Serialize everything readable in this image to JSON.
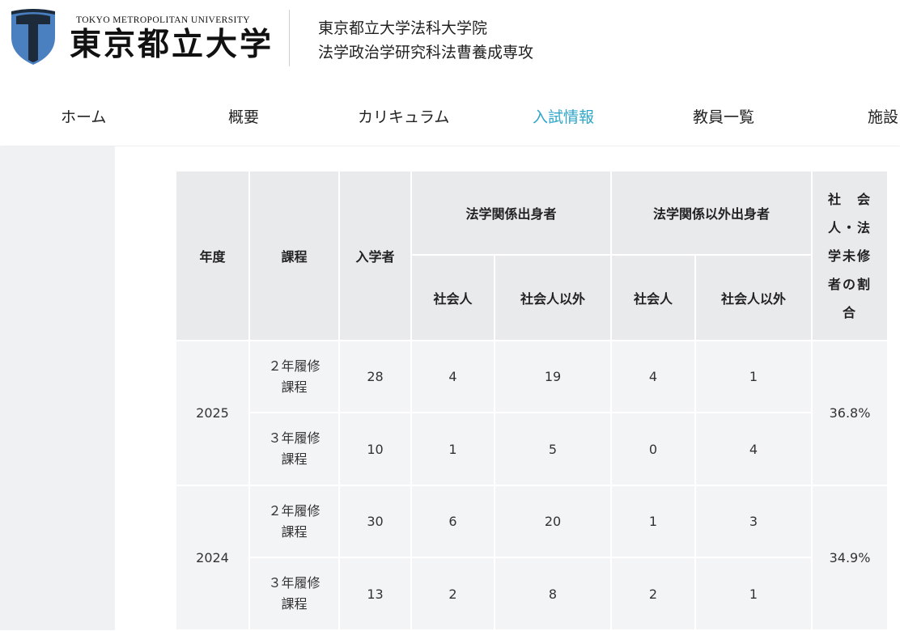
{
  "header": {
    "logo_en": "TOKYO METROPOLITAN UNIVERSITY",
    "logo_ja": "東京都立大学",
    "subtitle_line1": "東京都立大学法科大学院",
    "subtitle_line2": "法学政治学研究科法曹養成専攻",
    "shield_dark": "#1c2a3a",
    "shield_blue": "#4a7fc0"
  },
  "nav": {
    "items": [
      {
        "label": "ホーム"
      },
      {
        "label": "概要"
      },
      {
        "label": "カリキュラム"
      },
      {
        "label": "入試情報"
      },
      {
        "label": "教員一覧"
      },
      {
        "label": "施設"
      }
    ],
    "active": "入試情報",
    "active_color": "#2fa6c8"
  },
  "table": {
    "headers": {
      "year": "年度",
      "course": "課程",
      "entrants": "入学者",
      "law_background": "法学関係出身者",
      "non_law_background": "法学関係以外出身者",
      "working_adult": "社会人",
      "non_working_adult": "社会人以外",
      "ratio": "社会人・法学未修者の割合",
      "ratio_lines": [
        "社　会",
        "人・法",
        "学未修",
        "者の割",
        "合"
      ]
    },
    "rows": [
      {
        "year": "2025",
        "ratio": "36.8%",
        "courses": [
          {
            "course_line1": "２年履修",
            "course_line2": "課程",
            "entrants": "28",
            "law_adult": "4",
            "law_other": "19",
            "nonlaw_adult": "4",
            "nonlaw_other": "1"
          },
          {
            "course_line1": "３年履修",
            "course_line2": "課程",
            "entrants": "10",
            "law_adult": "1",
            "law_other": "5",
            "nonlaw_adult": "0",
            "nonlaw_other": "4"
          }
        ]
      },
      {
        "year": "2024",
        "ratio": "34.9%",
        "courses": [
          {
            "course_line1": "２年履修",
            "course_line2": "課程",
            "entrants": "30",
            "law_adult": "6",
            "law_other": "20",
            "nonlaw_adult": "1",
            "nonlaw_other": "3"
          },
          {
            "course_line1": "３年履修",
            "course_line2": "課程",
            "entrants": "13",
            "law_adult": "2",
            "law_other": "8",
            "nonlaw_adult": "2",
            "nonlaw_other": "1"
          }
        ]
      }
    ]
  }
}
